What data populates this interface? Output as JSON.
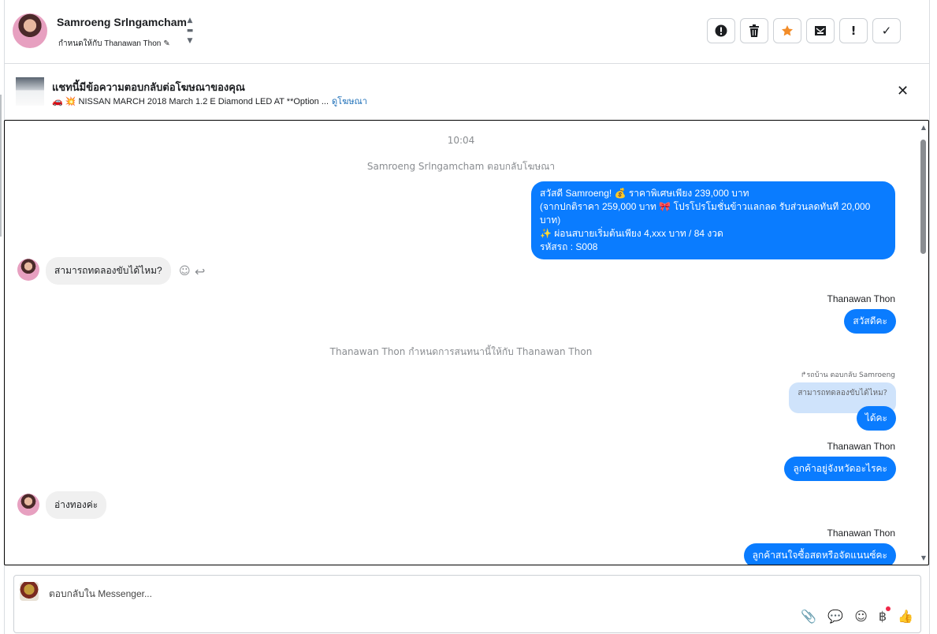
{
  "header": {
    "name": "Samroeng Srlngamcham",
    "assigned": "กำหนดให้กับ Thanawan Thon",
    "actions": [
      "alert-icon",
      "trash-icon",
      "star-icon",
      "mail-icon",
      "exclamation-icon",
      "check-icon"
    ]
  },
  "ad": {
    "title": "แชทนี้มีข้อความตอบกลับต่อโฆษณาของคุณ",
    "subtitle": "🚗 💥 NISSAN MARCH 2018 March 1.2 E Diamond LED AT **Option ...",
    "link": "ดูโฆษณา"
  },
  "chat": {
    "time": "10:04",
    "sys1": "Samroeng Srlngamcham ตอบกลับโฆษณา",
    "msg1": [
      "สวัสดี Samroeng! 💰 ราคาพิเศษเพียง 239,000 บาท",
      "(จากปกติราคา 259,000 บาท 🎀 โปรโปรโมชั่นข้าวแลกลด รับส่วนลดทันที 20,000 บาท)",
      "✨ ผ่อนสบายเริ่มต้นเพียง 4,xxx บาท / 84 งวด",
      "รหัสรถ : S008"
    ],
    "in1": "สามารถทดลองขับได้ไหม?",
    "sender1": "Thanawan Thon",
    "out2": "สวัสดีคะ",
    "sys2": "Thanawan Thon กำหนดการสนทนานี้ให้กับ Thanawan Thon",
    "reply_head": "↱รถบ้าน ตอบกลับ Samroeng",
    "quoted": "สามารถทดลองขับได้ไหม?",
    "out3": "ได้คะ",
    "sender2": "Thanawan Thon",
    "out4": "ลูกค้าอยู่จังหวัดอะไรคะ",
    "in2": "อ่างทองค่ะ",
    "sender3": "Thanawan Thon",
    "out5": "ลูกค้าสนใจซื้อสดหรือจัดแนนซ์คะ"
  },
  "composer": {
    "placeholder": "ตอบกลับใน Messenger..."
  }
}
